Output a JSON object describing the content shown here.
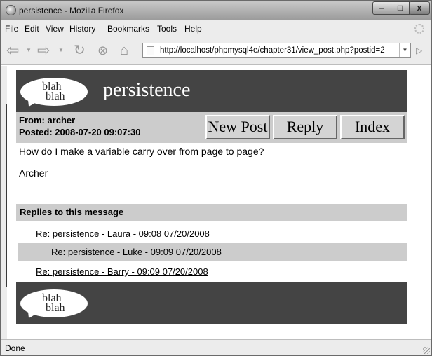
{
  "window": {
    "title": "persistence - Mozilla Firefox",
    "min_label": "–",
    "max_label": "□",
    "close_label": "x"
  },
  "menu": {
    "file": "File",
    "edit": "Edit",
    "view": "View",
    "history": "History",
    "bookmarks": "Bookmarks",
    "tools": "Tools",
    "help": "Help"
  },
  "nav": {
    "url": "http://localhost/phpmysql4e/chapter31/view_post.php?postid=2"
  },
  "page": {
    "logo_line1": "blah",
    "logo_line2": "blah",
    "site_title": "persistence",
    "from_line": "From: archer",
    "posted_line": "Posted: 2008-07-20 09:07:30",
    "new_post_label": "New Post",
    "reply_label": "Reply",
    "index_label": "Index",
    "message_body": "How do I make a variable carry over from page to page?",
    "message_author": "Archer",
    "replies_heading": "Replies to this message",
    "replies": [
      "Re: persistence - Laura - 09:08 07/20/2008",
      "Re: persistence - Luke - 09:09 07/20/2008",
      "Re: persistence - Barry - 09:09 07/20/2008"
    ]
  },
  "status": {
    "text": "Done"
  }
}
